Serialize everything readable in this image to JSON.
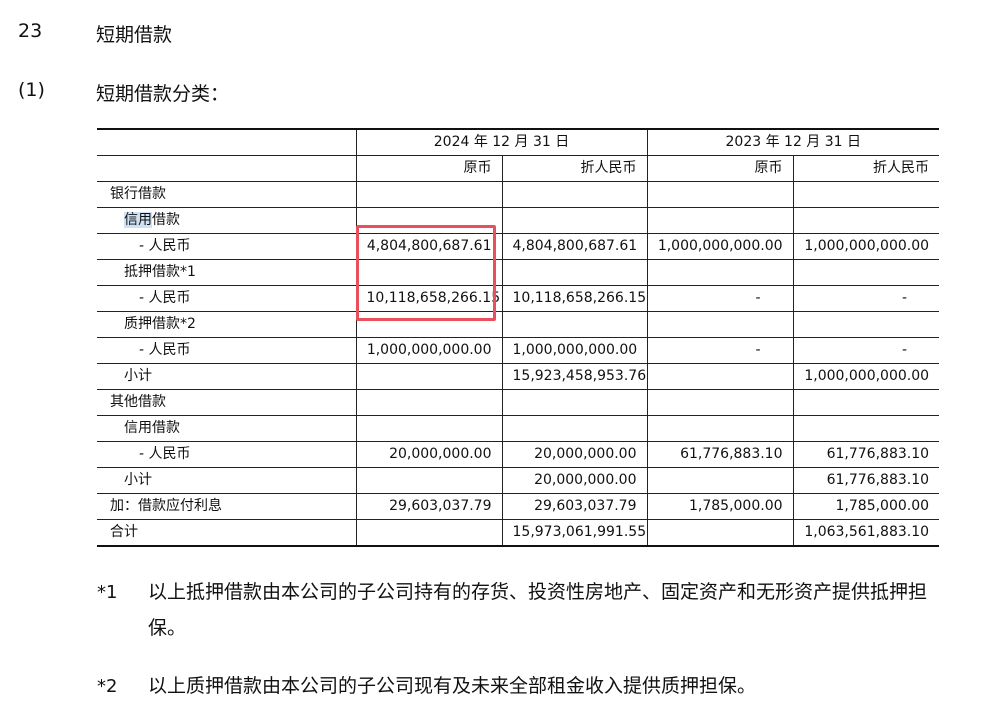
{
  "section": {
    "number": "23",
    "title": "短期借款"
  },
  "subsection": {
    "number": "(1)",
    "title": "短期借款分类："
  },
  "table": {
    "header_dates": [
      "2024 年 12 月 31 日",
      "2023 年 12 月 31 日"
    ],
    "sub_headers": [
      "原币",
      "折人民币",
      "原币",
      "折人民币"
    ],
    "rows": [
      {
        "label": "银行借款",
        "level": 1,
        "cells": [
          "",
          "",
          "",
          ""
        ]
      },
      {
        "label_hl": "信用",
        "label": "借款",
        "level": 2,
        "cells": [
          "",
          "",
          "",
          ""
        ]
      },
      {
        "label": "- 人民币",
        "level": 3,
        "cells": [
          "4,804,800,687.61",
          "4,804,800,687.61",
          "1,000,000,000.00",
          "1,000,000,000.00"
        ]
      },
      {
        "label": "抵押借款*1",
        "level": 2,
        "cells": [
          "",
          "",
          "",
          ""
        ]
      },
      {
        "label": "- 人民币",
        "level": 3,
        "cells": [
          "10,118,658,266.15",
          "10,118,658,266.15",
          "-",
          "-"
        ]
      },
      {
        "label": "质押借款*2",
        "level": 2,
        "cells": [
          "",
          "",
          "",
          ""
        ]
      },
      {
        "label": "- 人民币",
        "level": 3,
        "cells": [
          "1,000,000,000.00",
          "1,000,000,000.00",
          "-",
          "-"
        ]
      },
      {
        "label": "小计",
        "level": 2,
        "cells": [
          "",
          "15,923,458,953.76",
          "",
          "1,000,000,000.00"
        ]
      },
      {
        "label": "其他借款",
        "level": 1,
        "cells": [
          "",
          "",
          "",
          ""
        ]
      },
      {
        "label": "信用借款",
        "level": 2,
        "cells": [
          "",
          "",
          "",
          ""
        ]
      },
      {
        "label": "- 人民币",
        "level": 3,
        "cells": [
          "20,000,000.00",
          "20,000,000.00",
          "61,776,883.10",
          "61,776,883.10"
        ]
      },
      {
        "label": "小计",
        "level": 2,
        "cells": [
          "",
          "20,000,000.00",
          "",
          "61,776,883.10"
        ]
      },
      {
        "label": "加：借款应付利息",
        "level": 1,
        "cells": [
          "29,603,037.79",
          "29,603,037.79",
          "1,785,000.00",
          "1,785,000.00"
        ]
      },
      {
        "label": "合计",
        "level": 1,
        "cells": [
          "",
          "15,973,061,991.55",
          "",
          "1,063,561,883.10"
        ]
      }
    ]
  },
  "notes": [
    {
      "mark": "*1",
      "text": "以上抵押借款由本公司的子公司持有的存货、投资性房地产、固定资产和无形资产提供抵押担保。"
    },
    {
      "mark": "*2",
      "text": "以上质押借款由本公司的子公司现有及未来全部租金收入提供质押担保。"
    }
  ],
  "colors": {
    "highlight_box": "#e8505b",
    "selection": "#cfe2f5"
  }
}
